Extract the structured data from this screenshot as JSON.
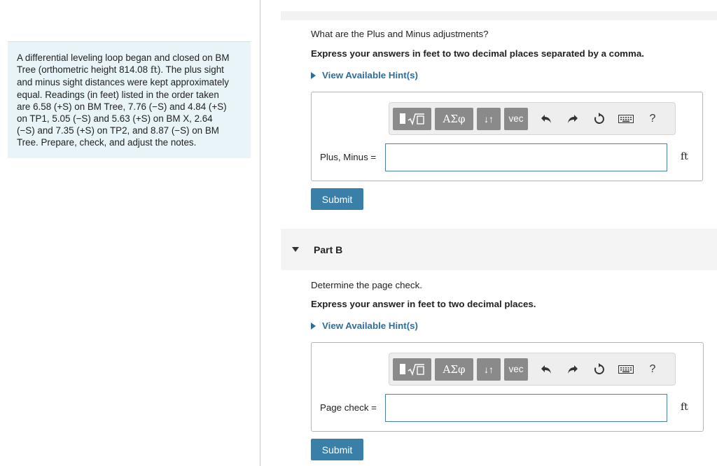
{
  "problem": {
    "lines": [
      "A differential leveling loop began and closed on BM",
      "Tree (orthometric height 814.08",
      "ft",
      "). The plus sight",
      "and minus sight distances were kept approximately",
      "equal. Readings (in feet) listed in the order taken",
      "are 6.58 (+S) on BM Tree, 7.76 (−S) and 4.84 (+S)",
      "on TP1, 5.05 (−S) and 5.63 (+S) on BM X, 2.64",
      "(−S) and 7.35 (+S) on TP2, and 8.87 (−S) on BM",
      "Tree. Prepare, check, and adjust the notes."
    ]
  },
  "toolbar": {
    "greek_label": "ΑΣφ",
    "arrows_label": "↓↑",
    "vec_label": "vec",
    "undo_glyph": "↶",
    "redo_glyph": "↷",
    "reset_glyph": "↻",
    "help_label": "?"
  },
  "partA": {
    "question": "What are the Plus and Minus adjustments?",
    "instruction": "Express your answers in feet to two decimal places separated by a comma.",
    "hint": "View Available Hint(s)",
    "answer_label": "Plus, Minus =",
    "answer_value": "",
    "unit": "ft",
    "submit": "Submit"
  },
  "partB": {
    "title": "Part B",
    "question": "Determine the page check.",
    "instruction": "Express your answer in feet to two decimal places.",
    "hint": "View Available Hint(s)",
    "answer_label": "Page check =",
    "answer_value": "",
    "unit": "ft",
    "submit": "Submit"
  },
  "colors": {
    "accent": "#3a7fa7",
    "hint": "#2a6fa0",
    "problem_bg": "#e8f4f8",
    "toolbar_button": "#8a8a8a"
  }
}
